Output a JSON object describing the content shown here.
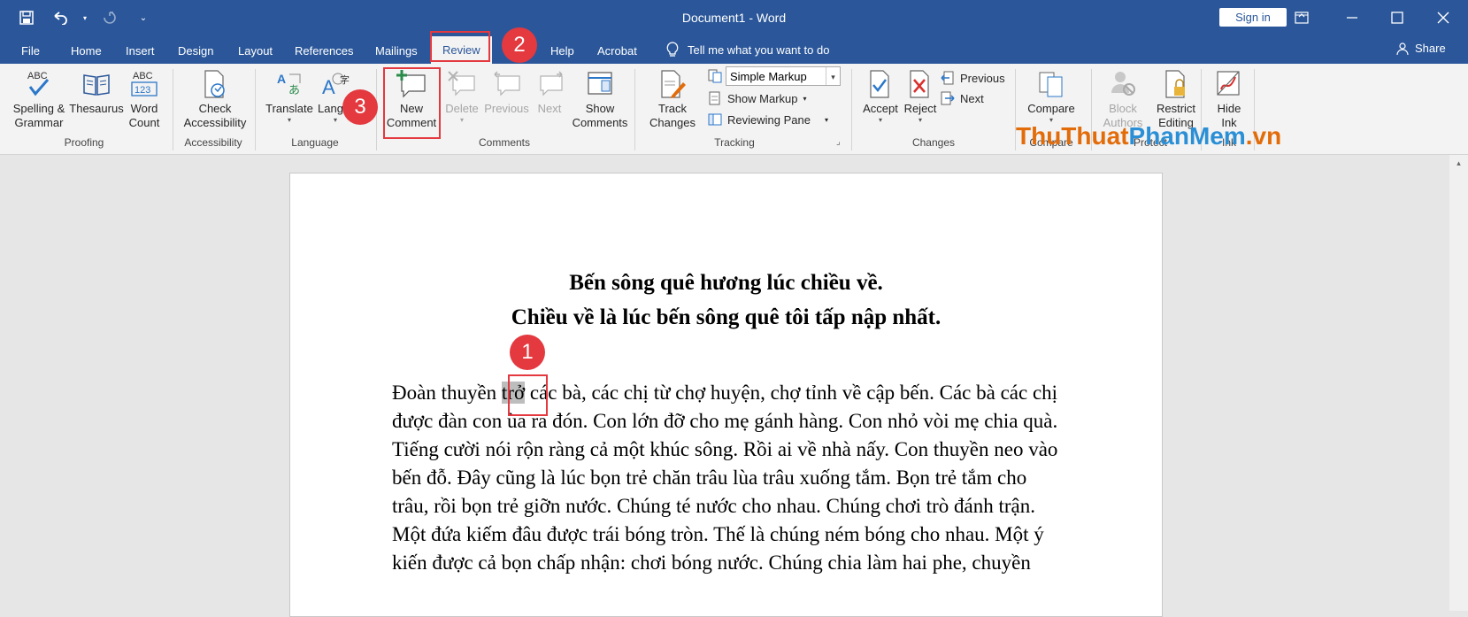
{
  "window": {
    "title": "Document1 - Word",
    "signin_label": "Sign in",
    "qat": [
      "save-icon",
      "undo-icon",
      "redo-icon",
      "customize-qat-icon"
    ]
  },
  "tabs": [
    "File",
    "Home",
    "Insert",
    "Design",
    "Layout",
    "References",
    "Mailings",
    "Review",
    "Help",
    "Acrobat"
  ],
  "active_tab": "Review",
  "tell_me": "Tell me what you want to do",
  "share": "Share",
  "ribbon": {
    "proofing": {
      "group": "Proofing",
      "spelling": "Spelling &\nGrammar",
      "thesaurus": "Thesaurus",
      "word_count": "Word\nCount"
    },
    "accessibility": {
      "group": "Accessibility",
      "check": "Check\nAccessibility"
    },
    "language": {
      "group": "Language",
      "translate": "Translate",
      "language": "Lang"
    },
    "comments": {
      "group": "Comments",
      "new": "New\nComment",
      "delete": "Delete",
      "previous": "Previous",
      "next": "Next",
      "show": "Show\nComments"
    },
    "tracking": {
      "group": "Tracking",
      "track_changes": "Track\nChanges",
      "markup_value": "Simple Markup",
      "show_markup": "Show Markup",
      "reviewing_pane": "Reviewing Pane"
    },
    "changes": {
      "group": "Changes",
      "accept": "Accept",
      "reject": "Reject",
      "previous": "Previous",
      "next": "Next"
    },
    "compare": {
      "group": "Compare",
      "compare": "Compare"
    },
    "protect": {
      "group": "Protect",
      "block": "Block\nAuthors",
      "restrict": "Restrict\nEditing"
    },
    "ink": {
      "group": "Ink",
      "hide_ink": "Hide\nInk"
    }
  },
  "watermark": {
    "part1": "ThuThuat",
    "part2": "PhanMem",
    "part3": ".vn",
    "color1": "#e36c0a",
    "color2": "#2b8fd6"
  },
  "document": {
    "heading1": "Bến sông quê hương lúc chiều về.",
    "heading2": "Chiều về là lúc bến sông quê tôi tấp nập nhất.",
    "para_before": "Đoàn thuyền ",
    "para_selected": "trở",
    "para_after": " các bà, các chị từ chợ huyện, chợ tỉnh về cập bến. Các bà các chị được đàn con ùa ra đón. Con lớn đỡ cho mẹ gánh hàng. Con nhỏ vòi mẹ chia quà. Tiếng cười nói rộn ràng cả một khúc sông. Rồi ai về nhà nấy. Con thuyền neo vào bến đỗ. Đây cũng là lúc bọn trẻ chăn trâu lùa trâu xuống tắm. Bọn trẻ tắm cho trâu, rồi bọn trẻ giỡn nước. Chúng té nước cho nhau. Chúng chơi trò đánh trận. Một đứa kiếm đâu được trái bóng tròn. Thế là chúng ném bóng cho nhau. Một ý kiến được cả bọn chấp nhận: chơi bóng nước. Chúng chia làm hai phe, chuyền"
  },
  "annotations": {
    "step1": "1",
    "step2": "2",
    "step3": "3",
    "color": "#e3393f"
  }
}
